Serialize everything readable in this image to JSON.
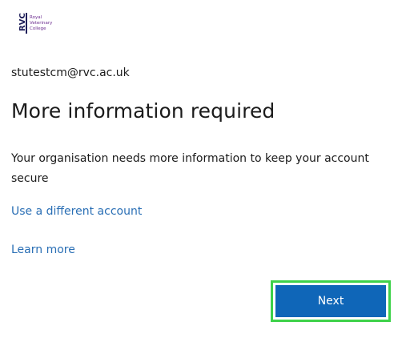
{
  "logo": {
    "mark_text": "RVC",
    "lines": [
      "Royal",
      "Veterinary",
      "College"
    ],
    "colors": {
      "mark": "#1f1f5a",
      "text": "#6b2b8f"
    }
  },
  "identity": {
    "email": "stutestcm@rvc.ac.uk"
  },
  "main": {
    "title": "More information required",
    "description": "Your organisation needs more information to keep your account secure",
    "use_different_account": "Use a different account",
    "learn_more": "Learn more"
  },
  "actions": {
    "next_label": "Next"
  },
  "colors": {
    "link": "#2a6fb5",
    "primary": "#0f66b8",
    "highlight": "#3ed24a"
  }
}
